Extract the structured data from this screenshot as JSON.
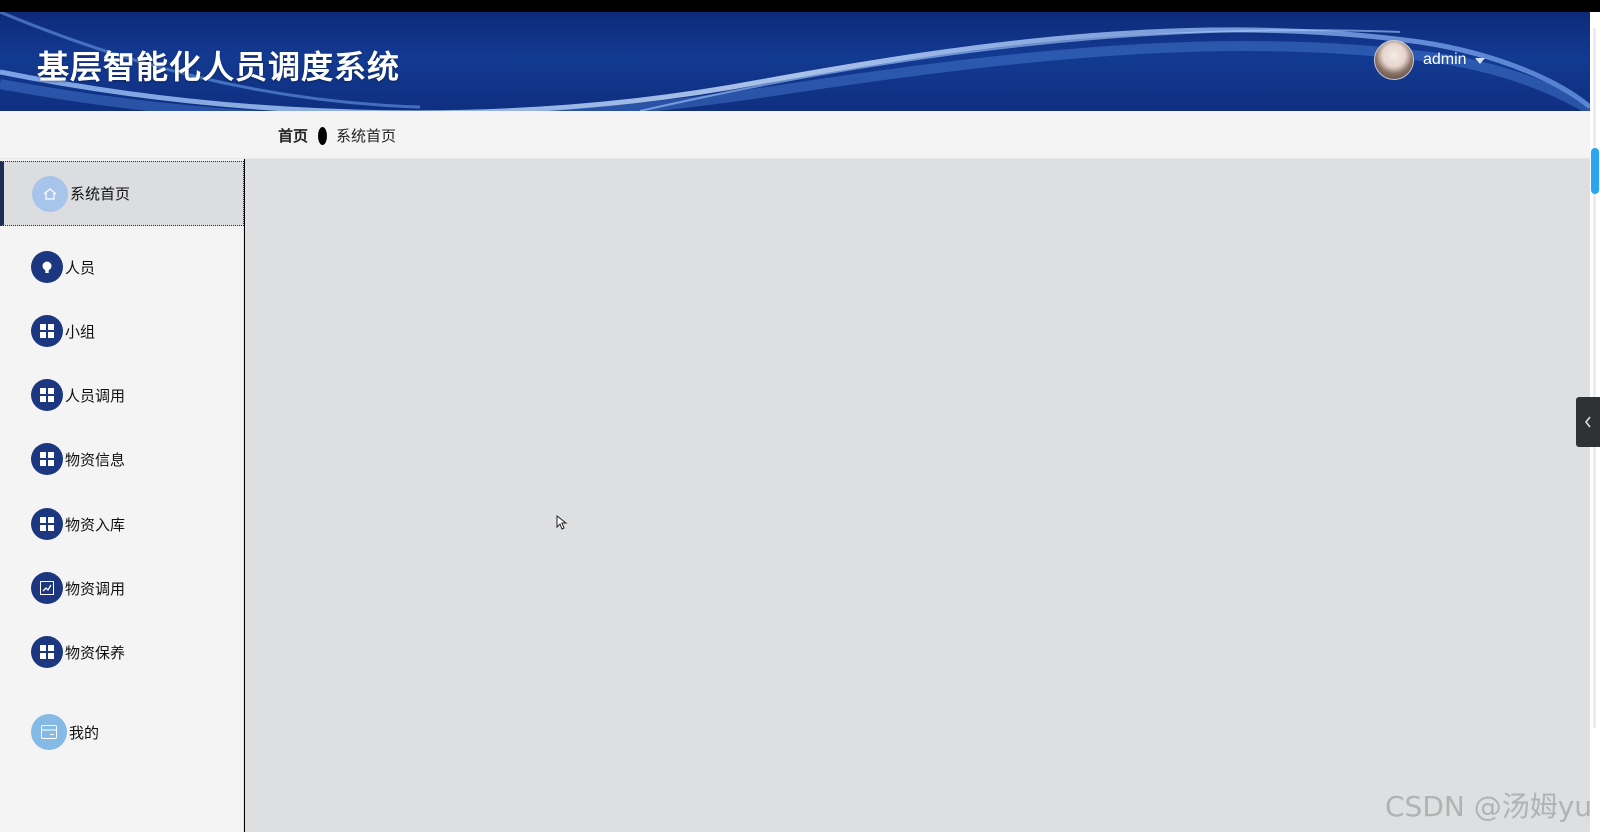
{
  "header": {
    "title": "基层智能化人员调度系统",
    "username": "admin"
  },
  "breadcrumb": {
    "home": "首页",
    "current": "系统首页"
  },
  "sidebar": {
    "items": [
      {
        "label": "系统首页",
        "icon": "home-icon",
        "active": true
      },
      {
        "label": "人员",
        "icon": "bulb-icon"
      },
      {
        "label": "小组",
        "icon": "grid-icon"
      },
      {
        "label": "人员调用",
        "icon": "grid-icon"
      },
      {
        "label": "物资信息",
        "icon": "grid-icon"
      },
      {
        "label": "物资入库",
        "icon": "grid-icon"
      },
      {
        "label": "物资调用",
        "icon": "chart-icon"
      },
      {
        "label": "物资保养",
        "icon": "grid-icon"
      },
      {
        "label": "我的",
        "icon": "card-icon"
      }
    ]
  },
  "watermark": "CSDN @汤姆yu",
  "colors": {
    "header_bg": "#133a92",
    "icon_bg": "#1c3680",
    "main_bg": "#dedfe1",
    "sidebar_bg": "#f4f4f4",
    "scroll_thumb": "#2aa5f2"
  }
}
